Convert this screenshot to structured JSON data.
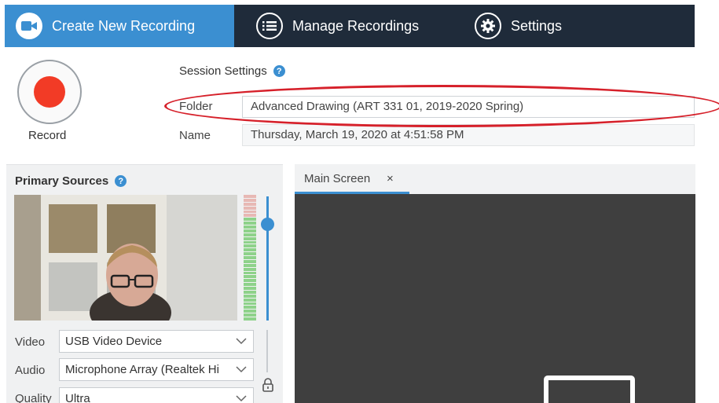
{
  "nav": {
    "tabs": [
      {
        "label": "Create New Recording",
        "icon": "video-camera-icon",
        "active": true
      },
      {
        "label": "Manage Recordings",
        "icon": "list-icon",
        "active": false
      },
      {
        "label": "Settings",
        "icon": "gear-icon",
        "active": false
      }
    ]
  },
  "record": {
    "label": "Record",
    "color": "#f23b26"
  },
  "session": {
    "title": "Session Settings",
    "help": "?",
    "folder_label": "Folder",
    "folder_value": "Advanced Drawing (ART 331 01, 2019-2020 Spring)",
    "name_label": "Name",
    "name_value": "Thursday, March 19, 2020 at 4:51:58 PM"
  },
  "primary": {
    "title": "Primary Sources",
    "help": "?",
    "video_label": "Video",
    "video_value": "USB Video Device",
    "audio_label": "Audio",
    "audio_value": "Microphone Array (Realtek Hi",
    "quality_label": "Quality",
    "quality_value": "Ultra"
  },
  "main_screen": {
    "tab_label": "Main Screen",
    "close": "×"
  },
  "colors": {
    "accent": "#3b8fd1",
    "nav_bg": "#1f2b3a",
    "highlight": "#d6202a",
    "screen_bg": "#3f3f3f"
  }
}
